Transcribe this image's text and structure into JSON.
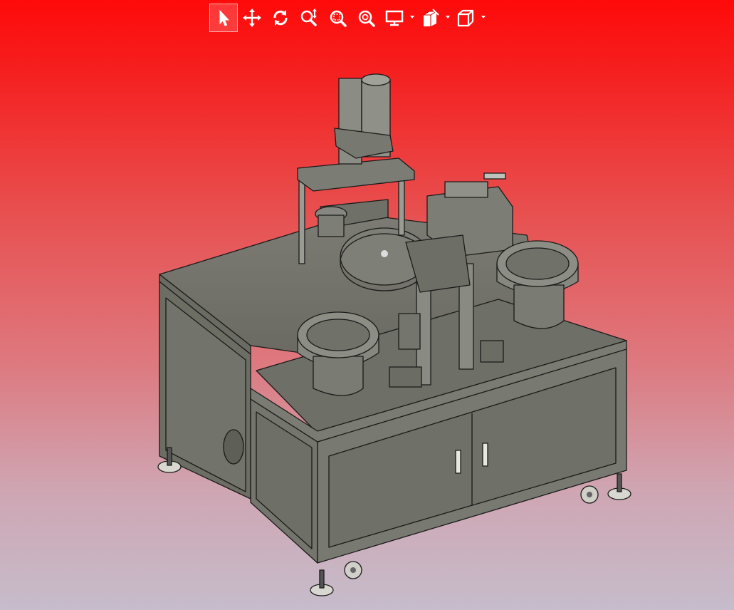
{
  "toolbar": {
    "tools": [
      {
        "icon": "select-arrow-icon",
        "active": true
      },
      {
        "icon": "pan-icon",
        "active": false
      },
      {
        "icon": "rotate-icon",
        "active": false
      },
      {
        "icon": "zoom-dynamic-icon",
        "active": false
      },
      {
        "icon": "zoom-window-icon",
        "active": false
      },
      {
        "icon": "zoom-fit-icon",
        "active": false
      },
      {
        "icon": "display-mode-icon",
        "active": false,
        "dropdown": true
      },
      {
        "icon": "section-view-icon",
        "active": false,
        "dropdown": true
      },
      {
        "icon": "view-orientation-cube-icon",
        "active": false,
        "dropdown": true
      }
    ]
  },
  "viewport": {
    "model": "automatic-assembly-machine-3d-model",
    "background_top": "#ff0a0a",
    "background_bottom": "#c6bccb",
    "model_color": "#6f6f66"
  }
}
